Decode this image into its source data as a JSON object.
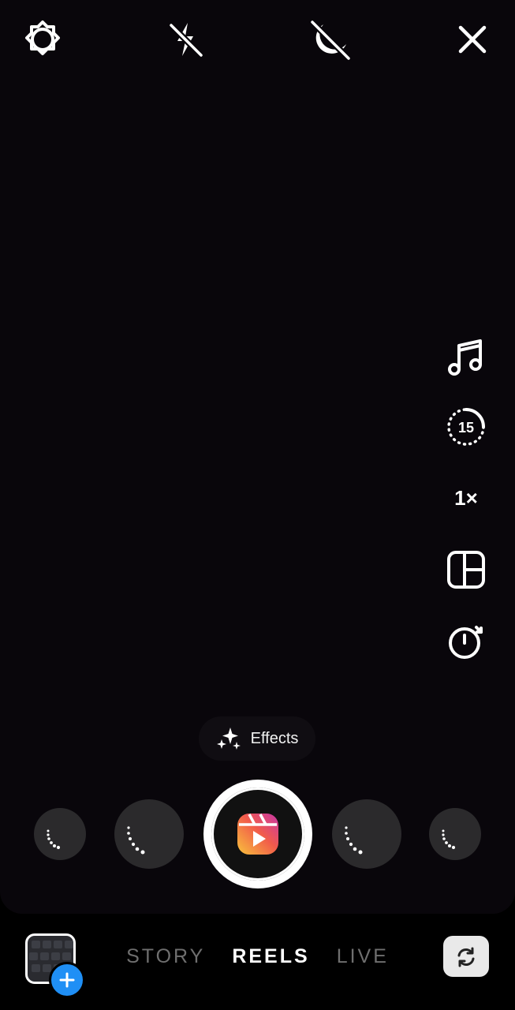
{
  "camera": {
    "top_icons": [
      "gear-icon",
      "flash-off-icon",
      "night-mode-off-icon",
      "close-icon"
    ],
    "side_tools": {
      "audio_icon": "music-note-icon",
      "length_value": "15",
      "speed_label": "1×",
      "layout_icon": "layout-grid-icon",
      "timer_icon": "stopwatch-icon"
    },
    "effects_label": "Effects",
    "shutter_icon": "reels-icon",
    "shutter_gradient": [
      "#f9c33c",
      "#f15b4a",
      "#c836a8"
    ]
  },
  "modes": {
    "items": [
      "STORY",
      "REELS",
      "LIVE"
    ],
    "active": "REELS"
  },
  "bottom": {
    "gallery_icon": "gallery-thumbnail",
    "add_icon": "plus-icon",
    "flip_icon": "flip-camera-icon",
    "add_color": "#1f8ff5"
  }
}
